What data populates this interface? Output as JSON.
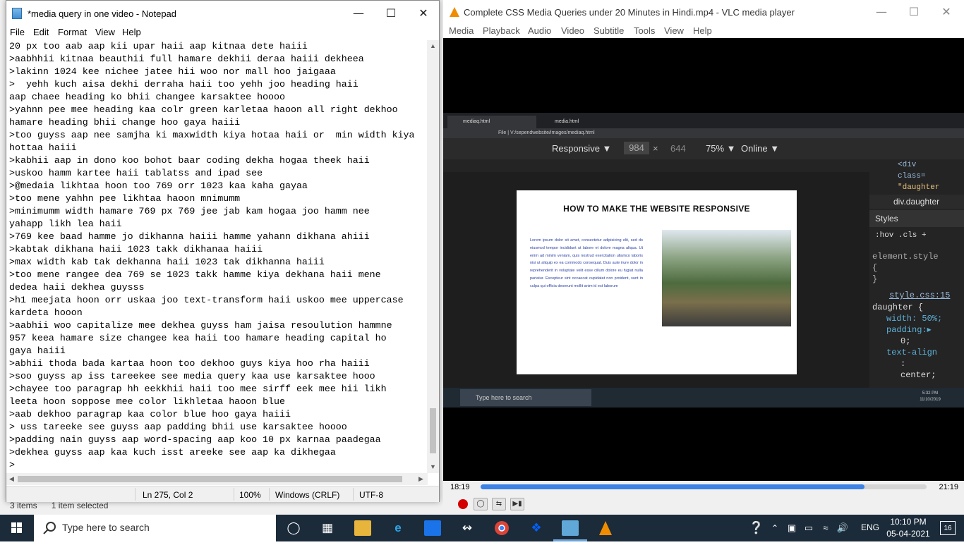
{
  "explorer": {
    "items": "3 items",
    "selected": "1 item selected"
  },
  "notepad": {
    "title": "*media query in one video - Notepad",
    "menu": [
      "File",
      "Edit",
      "Format",
      "View",
      "Help"
    ],
    "lines": [
      "20 px too aab aap kii upar haii aap kitnaa dete haiii",
      ">aabhhii kitnaa beauthii full hamare dekhii deraa haiii dekheea",
      ">lakinn 1024 kee nichee jatee hii woo nor mall hoo jaigaaa",
      ">  yehh kuch aisa dekhi derraha haii too yehh joo heading haii",
      "aap chaee heading ko bhii changee karsaktee hoooo",
      ">yahnn pee mee heading kaa colr green karletaa haoon all right dekhoo",
      "hamare heading bhii change hoo gaya haiii",
      ">too guyss aap nee samjha ki maxwidth kiya hotaa haii or  min width kiya",
      "hottaa haiii",
      ">kabhii aap in dono koo bohot baar coding dekha hogaa theek haii",
      ">uskoo hamm kartee haii tablatss and ipad see",
      ">@medaia likhtaa hoon too 769 orr 1023 kaa kaha gayaa",
      ">too mene yahhn pee likhtaa haoon mnimumm",
      ">minimumm width hamare 769 px 769 jee jab kam hogaa joo hamm nee",
      "yahapp likh lea haii",
      ">769 kee baad hamme jo dikhanna haiii hamme yahann dikhana ahiii",
      ">kabtak dikhana haii 1023 takk dikhanaa haiii",
      ">max width kab tak dekhanna haii 1023 tak dikhanna haiii",
      ">too mene rangee dea 769 se 1023 takk hamme kiya dekhana haii mene",
      "dedea haii dekhea guysss",
      ">h1 meejata hoon orr uskaa joo text-transform haii uskoo mee uppercase",
      "kardeta hooon",
      ">aabhii woo capitalize mee dekhea guyss ham jaisa resoulution hammne",
      "957 keea hamare size changee kea haii too hamare heading capital ho",
      "gaya haiii",
      ">abhii thoda bada kartaa hoon too dekhoo guys kiya hoo rha haiii",
      ">soo guyss ap iss tareekee see media query kaa use karsaktee hooo",
      ">chayee too paragrap hh eekkhii haii too mee sirff eek mee hii likh",
      "leeta hoon soppose mee color likhletaa haoon blue",
      ">aab dekhoo paragrap kaa color blue hoo gaya haiii",
      "> uss tareeke see guyss aap padding bhii use karsaktee hoooo",
      ">padding nain guyss aap word-spacing aap koo 10 px karnaa paadegaa",
      ">dekhea guyss aap kaa kuch isst areeke see aap ka dikhegaa",
      ">"
    ],
    "status": {
      "pos": "Ln 275, Col 2",
      "zoom": "100%",
      "eol": "Windows (CRLF)",
      "enc": "UTF-8"
    }
  },
  "vlc": {
    "title": "Complete CSS Media Queries under 20 Minutes in Hindi.mp4 - VLC media player",
    "menu": [
      "Media",
      "Playback",
      "Audio",
      "Video",
      "Subtitle",
      "Tools",
      "View",
      "Help"
    ],
    "time_elapsed": "18:19",
    "time_total": "21:19",
    "progress": 0.86,
    "video": {
      "tabs": [
        "mediaq.html",
        "media.html"
      ],
      "address": "File  |  V:/sependwebsite/images/mediaq.html",
      "device": "Responsive ▼",
      "width": "984",
      "x": "×",
      "height": "644",
      "zoom": "75% ▼",
      "throttle": "Online ▼",
      "page_heading": "HOW TO MAKE THE WEBSITE RESPONSIVE",
      "page_para": "Lorem ipsum dolor sit amet, consectetur adipisicing elit, sed do eiusmod tempor incididunt ut labore et dolore magna aliqua. Ut enim ad minim veniam, quis nostrud exercitation ullamco laboris nisi ut aliquip ex ea commodo consequat. Duis aute irure dolor in reprehenderit in voluptate velit esse cillum dolore eu fugiat nulla pariatur. Excepteur sint occaecat cupidatat non proident, sunt in culpa qui officia deserunt mollit anim id est laborum",
      "devtools": {
        "code1": "<div",
        "code2": "class=",
        "code3": "\"daughter",
        "breadcrumb": "div.daughter",
        "styles_tab": "Styles",
        "hov": ":hov  .cls  +",
        "elstyle": "element.style",
        "brace_open": "{",
        "brace_close": "}",
        "source": "style.css:15",
        "selector": "daughter {",
        "p1": "width: 50%;",
        "p2": "padding:▸",
        "p2b": "0;",
        "p3": "text-align",
        ":": ":",
        "p3b": "center;"
      },
      "inner_search": "Type here to search",
      "inner_clock": "5:32 PM\n11/10/2019"
    }
  },
  "taskbar": {
    "search_placeholder": "Type here to search",
    "lang": "ENG",
    "time": "10:10 PM",
    "date": "05-04-2021",
    "notif": "16"
  }
}
